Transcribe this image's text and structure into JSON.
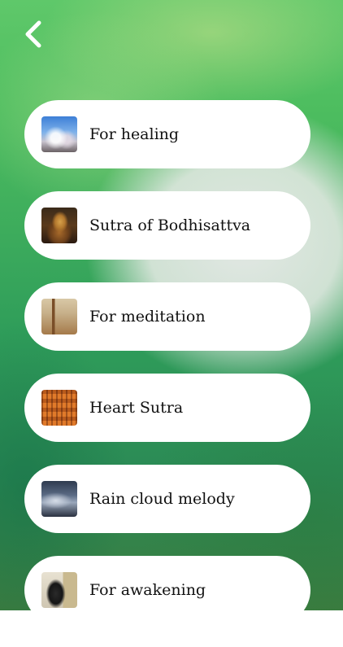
{
  "nav": {
    "back_icon": "chevron-left-icon"
  },
  "items": [
    {
      "label": "For healing",
      "thumb": "healing-thumbnail"
    },
    {
      "label": "Sutra of Bodhisattva",
      "thumb": "bodhisattva-thumbnail"
    },
    {
      "label": "For meditation",
      "thumb": "meditation-thumbnail"
    },
    {
      "label": "Heart Sutra",
      "thumb": "heart-sutra-thumbnail"
    },
    {
      "label": "Rain cloud melody",
      "thumb": "rain-cloud-thumbnail"
    },
    {
      "label": "For awakening",
      "thumb": "awakening-thumbnail"
    }
  ],
  "colors": {
    "card": "#ffffff",
    "text": "#111111",
    "background_green": "#3da85c"
  }
}
